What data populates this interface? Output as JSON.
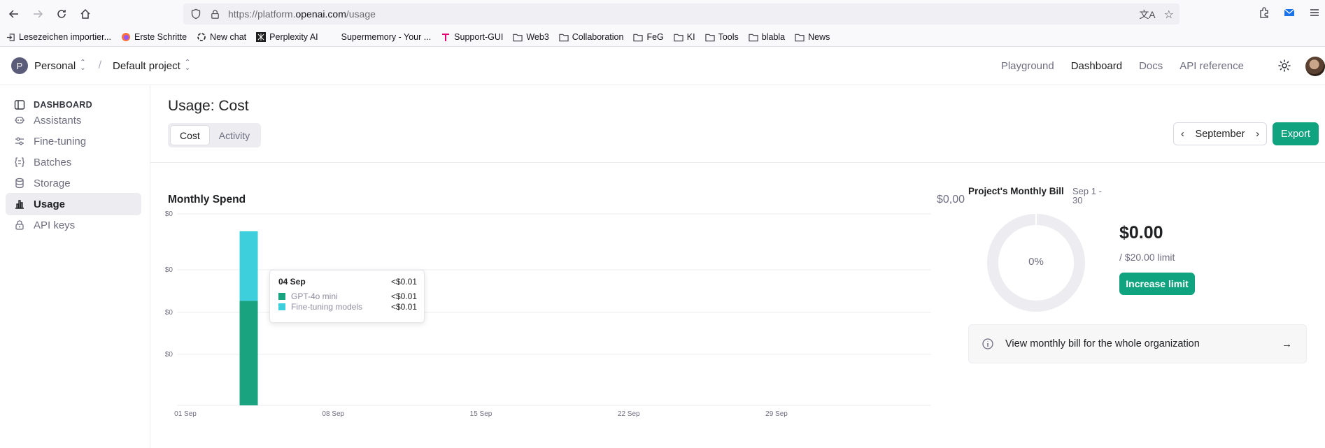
{
  "browser": {
    "url_prefix": "https://platform.",
    "url_domain": "openai.com",
    "url_path": "/usage",
    "bookmarks": [
      {
        "label": "Lesezeichen importier...",
        "icon": "import-icon"
      },
      {
        "label": "Erste Schritte",
        "icon": "firefox-icon"
      },
      {
        "label": "New chat",
        "icon": "openai-icon"
      },
      {
        "label": "Perplexity AI",
        "icon": "perplexity-icon"
      },
      {
        "label": "Supermemory - Your ...",
        "icon": "blank-icon"
      },
      {
        "label": "Support-GUI",
        "icon": "telekom-icon"
      },
      {
        "label": "Web3",
        "icon": "folder-icon"
      },
      {
        "label": "Collaboration",
        "icon": "folder-icon"
      },
      {
        "label": "FeG",
        "icon": "folder-icon"
      },
      {
        "label": "KI",
        "icon": "folder-icon"
      },
      {
        "label": "Tools",
        "icon": "folder-icon"
      },
      {
        "label": "blabla",
        "icon": "folder-icon"
      },
      {
        "label": "News",
        "icon": "folder-icon"
      }
    ]
  },
  "header": {
    "org_initial": "P",
    "org_name": "Personal",
    "project_name": "Default project",
    "nav": [
      "Playground",
      "Dashboard",
      "Docs",
      "API reference"
    ],
    "active_nav": "Dashboard"
  },
  "sidebar": {
    "heading": "DASHBOARD",
    "items": [
      {
        "label": "Assistants",
        "icon": "robot-icon"
      },
      {
        "label": "Fine-tuning",
        "icon": "sliders-icon"
      },
      {
        "label": "Batches",
        "icon": "braces-icon"
      },
      {
        "label": "Storage",
        "icon": "database-icon"
      },
      {
        "label": "Usage",
        "icon": "bar-chart-icon",
        "active": true
      },
      {
        "label": "API keys",
        "icon": "lock-icon"
      }
    ]
  },
  "main": {
    "title": "Usage: Cost",
    "tabs": [
      "Cost",
      "Activity"
    ],
    "active_tab": "Cost",
    "month": "September",
    "export_label": "Export",
    "spend_title": "Monthly Spend",
    "spend_total": "$0,00"
  },
  "chart_data": {
    "type": "bar",
    "stacked": true,
    "y_tick_labels": [
      "$0",
      "$0",
      "$0",
      "$0"
    ],
    "x_tick_labels": [
      "01 Sep",
      "08 Sep",
      "15 Sep",
      "22 Sep",
      "29 Sep"
    ],
    "categories_range": [
      "01 Sep",
      "30 Sep"
    ],
    "series": [
      {
        "name": "GPT-4o mini",
        "color": "#19a37f",
        "points": [
          {
            "date": "04 Sep",
            "value": 0.006
          }
        ]
      },
      {
        "name": "Fine-tuning models",
        "color": "#3ecfdc",
        "points": [
          {
            "date": "04 Sep",
            "value": 0.004
          }
        ]
      }
    ],
    "ylim": [
      0,
      0.011
    ],
    "grid": true,
    "tooltip": {
      "date": "04 Sep",
      "total": "<$0.01",
      "rows": [
        {
          "name": "GPT-4o mini",
          "value": "<$0.01",
          "color": "#19a37f"
        },
        {
          "name": "Fine-tuning models",
          "value": "<$0.01",
          "color": "#3ecfdc"
        }
      ]
    }
  },
  "bill": {
    "title": "Project's Monthly Bill",
    "range": "Sep 1 - 30",
    "percent_label": "0%",
    "percent_value": 0,
    "amount": "$0.00",
    "limit": "/ $20.00 limit",
    "increase_label": "Increase limit",
    "org_link": "View monthly bill for the whole organization"
  },
  "colors": {
    "accent": "#10a37f",
    "gpt4o_mini": "#19a37f",
    "fine_tuning": "#3ecfdc"
  }
}
